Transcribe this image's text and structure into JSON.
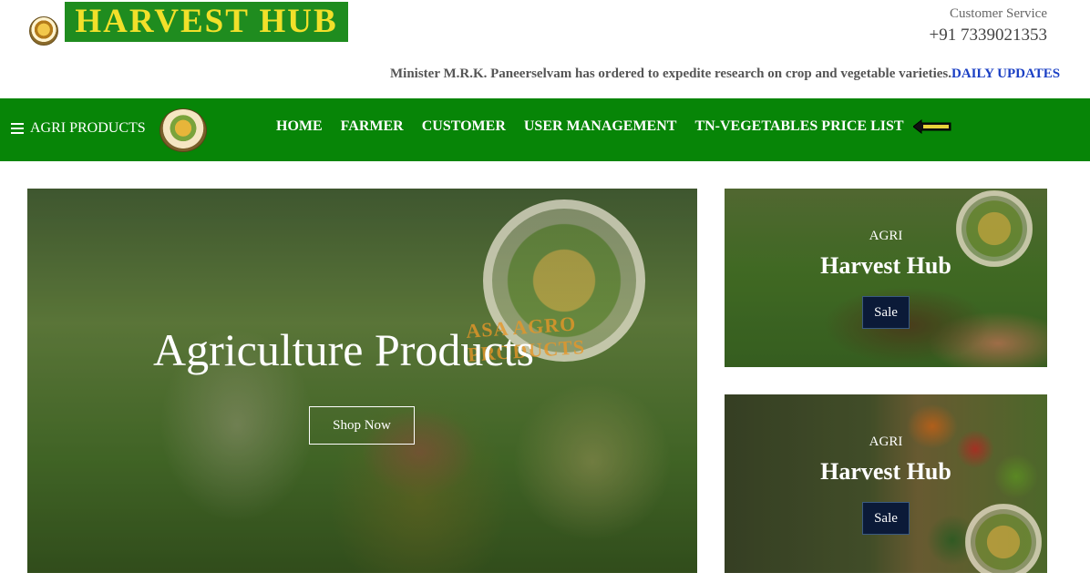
{
  "header": {
    "brand": "HARVEST  HUB",
    "customer_service_label": "Customer Service",
    "phone": "+91 7339021353"
  },
  "ticker": {
    "text": "Minister M.R.K. Paneerselvam has ordered to expedite research on crop and vegetable varieties.",
    "highlight": "DAILY UPDATES"
  },
  "nav": {
    "menu_label": "AGRI PRODUCTS",
    "links": [
      "HOME",
      "FARMER",
      "CUSTOMER",
      "USER MANAGEMENT",
      "TN-VEGETABLES PRICE LIST"
    ]
  },
  "hero": {
    "title": "Agriculture Products",
    "button": "Shop Now",
    "seal_text": "ASA AGRO PRODUCTS"
  },
  "cards": [
    {
      "subtitle": "AGRI",
      "title": "Harvest Hub",
      "button": "Sale"
    },
    {
      "subtitle": "AGRI",
      "title": "Harvest Hub",
      "button": "Sale"
    }
  ],
  "colors": {
    "nav_green": "#078507",
    "brand_green": "#1f8c1f",
    "brand_text": "#f2e02a",
    "ticker_highlight": "#1a3fc4",
    "sale_button": "#0b1a38"
  }
}
